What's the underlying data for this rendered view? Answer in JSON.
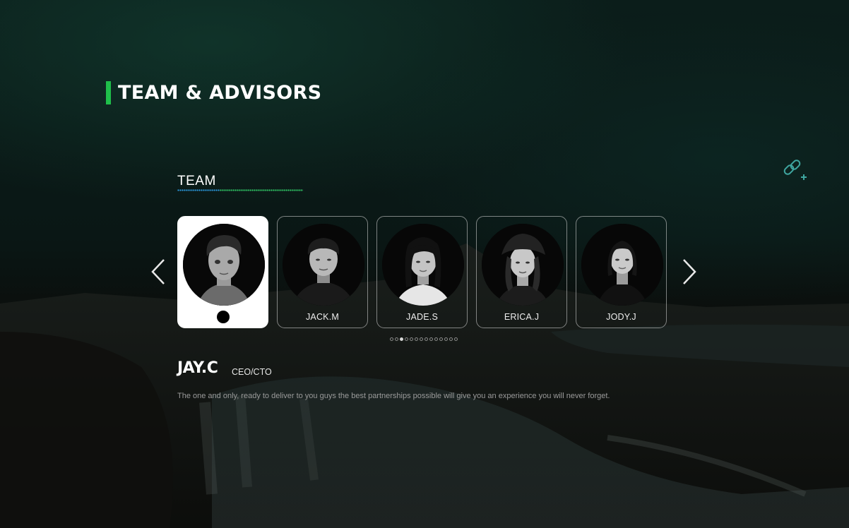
{
  "section": {
    "title": "TEAM & ADVISORS"
  },
  "team": {
    "heading": "TEAM",
    "members": [
      {
        "name": "JAY.C",
        "active": true
      },
      {
        "name": "JACK.M",
        "active": false
      },
      {
        "name": "JADE.S",
        "active": false
      },
      {
        "name": "ERICA.J",
        "active": false
      },
      {
        "name": "JODY.J",
        "active": false
      }
    ],
    "pagination": {
      "total": 14,
      "current": 3
    }
  },
  "selected": {
    "name": "JAY.C",
    "role": "CEO/CTO",
    "description": "The one and only, ready to deliver to you guys the best partnerships possible will give you an experience you will never forget."
  },
  "icons": {
    "prev": "chevron-left-icon",
    "next": "chevron-right-icon",
    "link": "link-add-icon"
  },
  "colors": {
    "accent_green": "#1fbf4a",
    "accent_blue": "#2a9ae0",
    "link_icon": "#3fa6a0",
    "card_active": "#ffffff"
  }
}
